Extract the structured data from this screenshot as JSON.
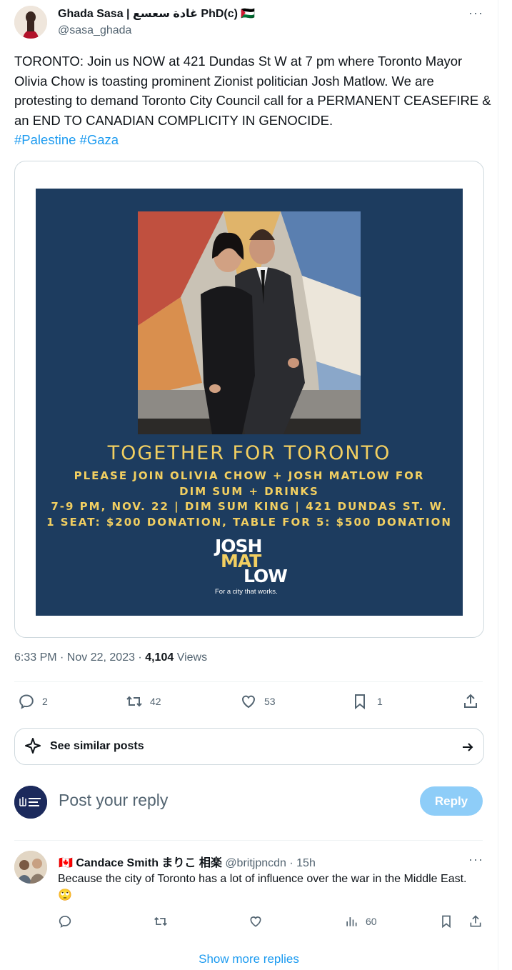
{
  "tweet": {
    "author_name": "Ghada Sasa | غادة سعسع PhD(c) 🇵🇸",
    "author_handle": "@sasa_ghada",
    "text": "TORONTO: Join us NOW at 421 Dundas St W at 7 pm where Toronto Mayor Olivia Chow is toasting prominent Zionist politician Josh Matlow. We are protesting to demand Toronto City Council call for a PERMANENT CEASEFIRE & an END TO CANADIAN COMPLICITY IN GENOCIDE.",
    "hashtags": "#Palestine #Gaza",
    "poster": {
      "title": "TOGETHER FOR TORONTO",
      "line1": "PLEASE JOIN OLIVIA CHOW + JOSH MATLOW FOR",
      "line2": "DIM SUM + DRINKS",
      "line3": "7-9 PM, NOV. 22 | DIM SUM KING | 421 DUNDAS ST. W.",
      "line4": "1 SEAT: $200 DONATION, TABLE FOR 5: $500 DONATION",
      "logo_l1": "JOSH",
      "logo_l2": "MAT",
      "logo_l3": "LOW",
      "logo_tagline": "For a city that works."
    },
    "time": "6:33 PM · Nov 22, 2023 · ",
    "views_count": "4,104",
    "views_label": " Views",
    "stats": {
      "replies": "2",
      "reposts": "42",
      "likes": "53",
      "bookmarks": "1"
    }
  },
  "similar": {
    "label": "See similar posts"
  },
  "composer": {
    "placeholder": "Post your reply",
    "button": "Reply"
  },
  "reply": {
    "flag": "🇨🇦",
    "name": "Candace Smith まりこ 相楽",
    "handle": "@britjpncdn · 15h",
    "text": "Because the city of Toronto has a lot of influence over the war in the Middle East. 🙄",
    "views": "60"
  },
  "show_more": "Show more replies",
  "colors": {
    "accent": "#1d9bf0",
    "poster_bg": "#1d3c5f",
    "poster_text": "#f2cf61"
  }
}
